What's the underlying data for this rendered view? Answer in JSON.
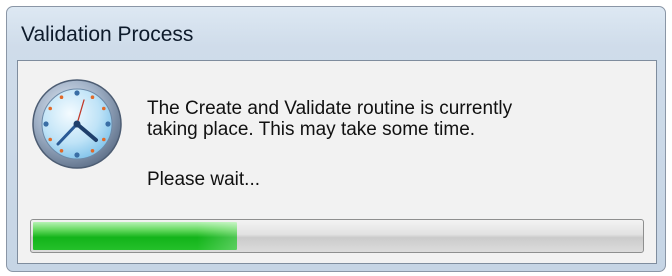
{
  "window": {
    "title": "Validation Process"
  },
  "dialog": {
    "icon": "clock-icon",
    "message_lines": [
      "The Create and Validate routine is currently",
      "taking place. This may take some time."
    ],
    "wait_text": "Please wait..."
  },
  "progress": {
    "percent": 34,
    "fill_color": "#1fba24"
  }
}
